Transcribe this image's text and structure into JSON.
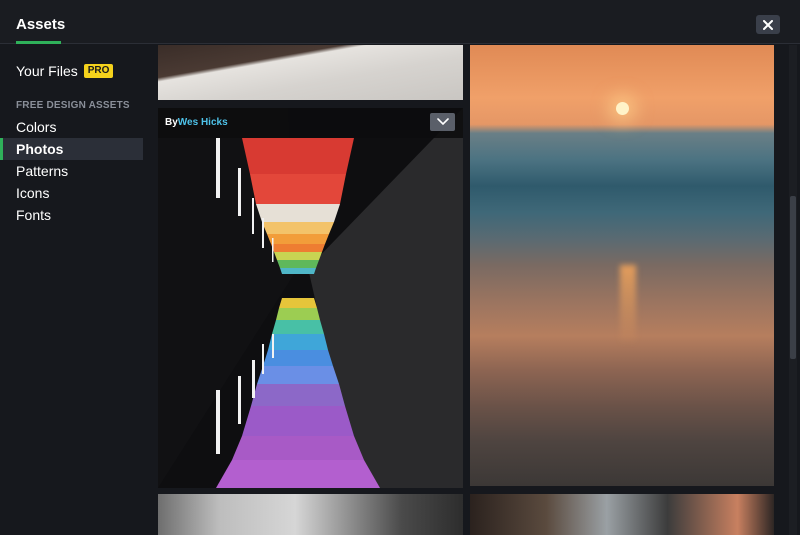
{
  "header": {
    "title": "Assets",
    "close_icon": "close-icon"
  },
  "sidebar": {
    "your_files": "Your Files",
    "pro_badge": "PRO",
    "section_label": "FREE DESIGN ASSETS",
    "items": [
      {
        "label": "Colors",
        "active": false
      },
      {
        "label": "Photos",
        "active": true
      },
      {
        "label": "Patterns",
        "active": false
      },
      {
        "label": "Icons",
        "active": false
      },
      {
        "label": "Fonts",
        "active": false
      }
    ]
  },
  "photos": {
    "featured": {
      "by_label": "By",
      "author": "Wes Hicks",
      "dropdown_icon": "chevron-down-icon"
    }
  },
  "colors": {
    "accent": "#2fb15a",
    "badge": "#f5d21c",
    "link": "#4ec3ea",
    "background": "#16181d"
  }
}
